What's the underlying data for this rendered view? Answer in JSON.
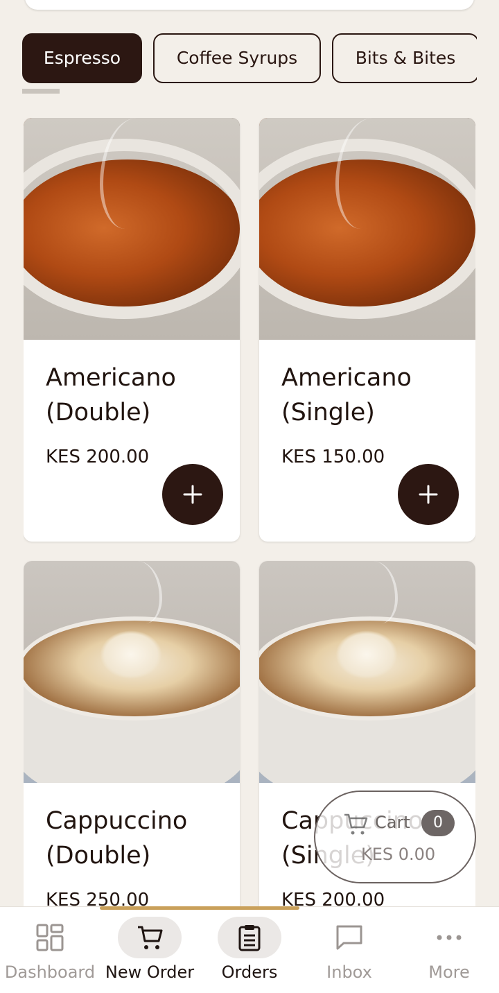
{
  "categories": [
    {
      "label": "Espresso",
      "active": true
    },
    {
      "label": "Coffee Syrups",
      "active": false
    },
    {
      "label": "Bits & Bites",
      "active": false
    }
  ],
  "products": [
    {
      "name": "Americano (Double)",
      "price": "KES 200.00",
      "image": "americano"
    },
    {
      "name": "Americano (Single)",
      "price": "KES 150.00",
      "image": "americano"
    },
    {
      "name": "Cappuccino (Double)",
      "price": "KES 250.00",
      "image": "cappuccino"
    },
    {
      "name": "Cappuccino (Single)",
      "price": "KES 200.00",
      "image": "cappuccino"
    }
  ],
  "cart": {
    "label": "Cart",
    "count": "0",
    "total": "KES 0.00"
  },
  "nav": [
    {
      "label": "Dashboard",
      "icon": "grid-icon"
    },
    {
      "label": "New Order",
      "icon": "cart-icon"
    },
    {
      "label": "Orders",
      "icon": "clipboard-icon"
    },
    {
      "label": "Inbox",
      "icon": "message-icon"
    },
    {
      "label": "More",
      "icon": "more-icon"
    }
  ],
  "colors": {
    "brand_dark": "#2c1712",
    "background": "#f3efe9",
    "accent": "#c9a05a"
  }
}
